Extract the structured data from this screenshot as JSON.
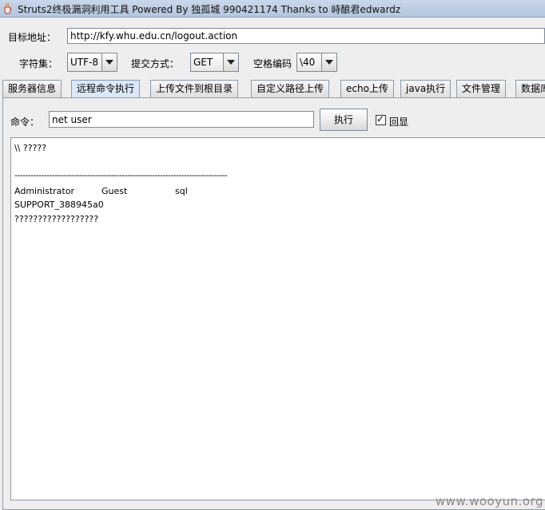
{
  "window": {
    "title": "Struts2终极漏洞利用工具   Powered By 独孤城 990421174 Thanks to 峙酿君edwardz"
  },
  "target": {
    "label": "目标地址：",
    "url": "http://kfy.whu.edu.cn/logout.action"
  },
  "options": {
    "charset_label": "字符集：",
    "charset_value": "UTF-8",
    "method_label": "提交方式：",
    "method_value": "GET",
    "space_label": "空格编码",
    "space_value": "\\40"
  },
  "tabs": [
    {
      "label": "服务器信息",
      "active": false
    },
    {
      "label": "远程命令执行",
      "active": true
    },
    {
      "label": "上传文件到根目录",
      "active": false
    },
    {
      "label": "自定义路径上传",
      "active": false
    },
    {
      "label": "echo上传",
      "active": false
    },
    {
      "label": "java执行",
      "active": false
    },
    {
      "label": "文件管理",
      "active": false
    },
    {
      "label": "数据库",
      "active": false
    }
  ],
  "command": {
    "label": "命令：",
    "value": "net user",
    "execute_label": "执行",
    "echo_label": "回显",
    "echo_checked": true
  },
  "output": {
    "line1": "\\\\ ?????",
    "separator": "-------------------------------------------------------------------------------",
    "users": [
      "Administrator",
      "Guest",
      "sql"
    ],
    "line3": "SUPPORT_388945a0",
    "line4": "??????????????????"
  },
  "watermark": "www.wooyun.org"
}
